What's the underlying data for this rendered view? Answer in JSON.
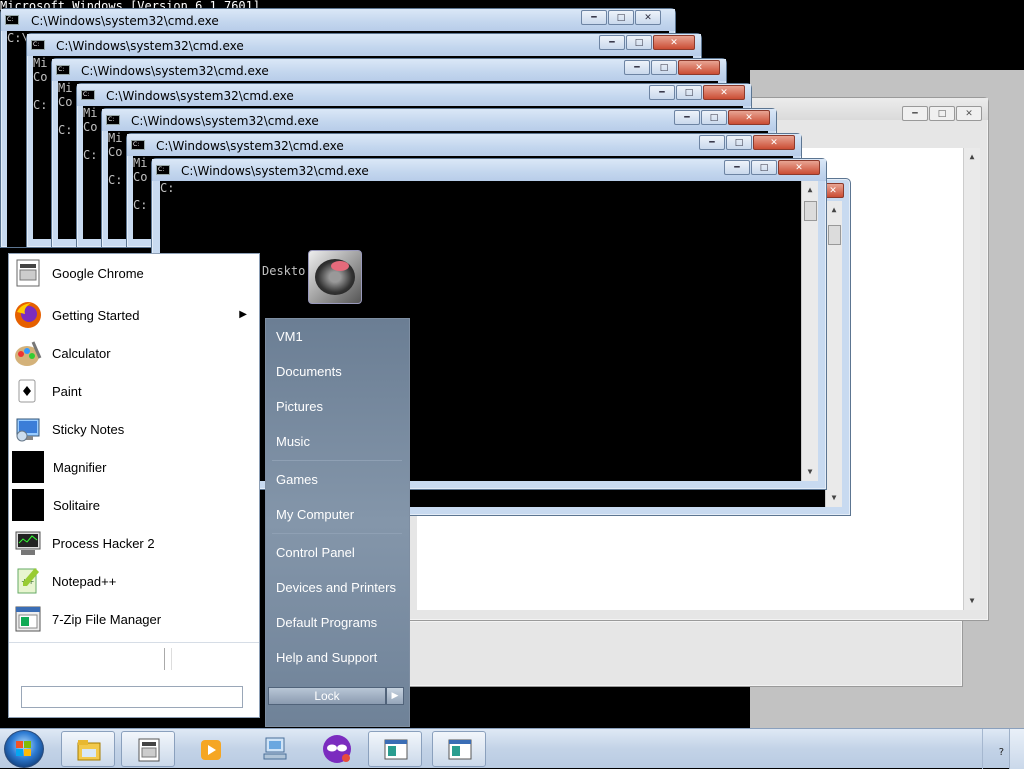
{
  "console_header": "Microsoft Windows [Version 6.1.7601]",
  "console_behind": [
    "C:\\",
    "Mi",
    "Co",
    "C:"
  ],
  "cmd_windows": [
    {
      "title": "C:\\Windows\\system32\\cmd.exe"
    },
    {
      "title": "C:\\Windows\\system32\\cmd.exe"
    },
    {
      "title": "C:\\Windows\\system32\\cmd.exe"
    },
    {
      "title": "C:\\Windows\\system32\\cmd.exe"
    },
    {
      "title": "C:\\Windows\\system32\\cmd.exe"
    },
    {
      "title": "C:\\Windows\\system32\\cmd.exe"
    },
    {
      "title": "C:\\Windows\\system32\\cmd.exe"
    }
  ],
  "desktop_partial_text": "Deskto     a",
  "start_menu": {
    "programs": [
      {
        "label": "Google Chrome",
        "icon": "chrome-icon"
      },
      {
        "label": "Getting Started",
        "icon": "firefox-icon",
        "has_submenu": true
      },
      {
        "label": "Calculator",
        "icon": "calculator-icon"
      },
      {
        "label": "Paint",
        "icon": "paint-icon"
      },
      {
        "label": "Sticky Notes",
        "icon": "sticky-notes-icon"
      },
      {
        "label": "Magnifier",
        "icon": "magnifier-icon"
      },
      {
        "label": "Solitaire",
        "icon": "solitaire-icon"
      },
      {
        "label": "Process Hacker 2",
        "icon": "process-hacker-icon"
      },
      {
        "label": "Notepad++",
        "icon": "notepadpp-icon"
      },
      {
        "label": "7-Zip File Manager",
        "icon": "7zip-icon"
      }
    ],
    "search_placeholder": "",
    "right_links": {
      "user": "VM1",
      "documents": "Documents",
      "pictures": "Pictures",
      "music": "Music",
      "games": "Games",
      "computer": "My Computer",
      "control_panel": "Control Panel",
      "devices": "Devices and Printers",
      "default_programs": "Default Programs",
      "help": "Help and Support"
    },
    "lock_label": "Lock",
    "submenu_arrow": "▶"
  },
  "taskbar": {
    "buttons": [
      {
        "icon": "explorer-icon"
      },
      {
        "icon": "chrome-generic-icon"
      },
      {
        "icon": "media-player-icon"
      },
      {
        "icon": "network-icon"
      },
      {
        "icon": "tor-mask-icon"
      },
      {
        "icon": "cmd-window-icon"
      },
      {
        "icon": "cmd-window-icon"
      }
    ],
    "tray_text": "?"
  }
}
